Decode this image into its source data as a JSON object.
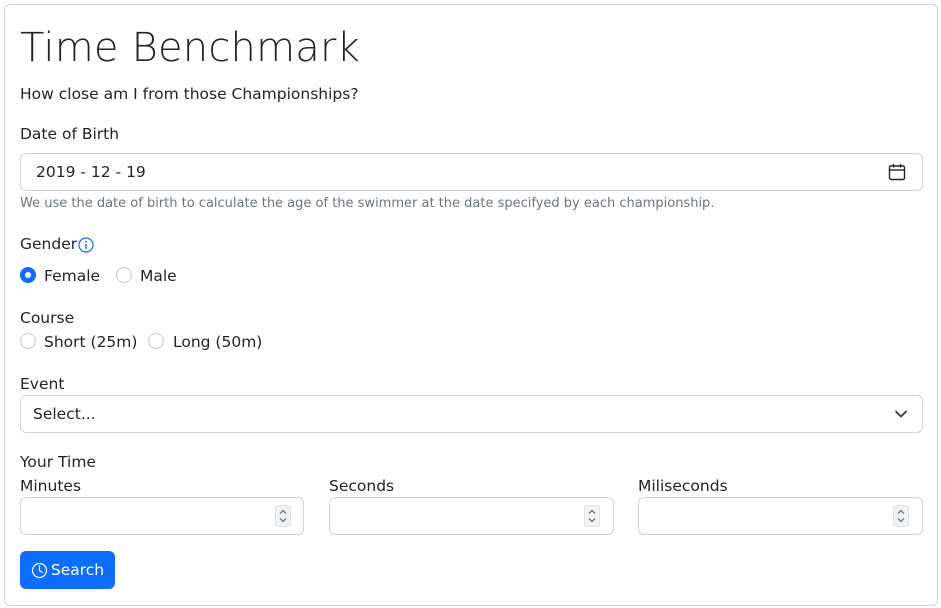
{
  "page": {
    "title": "Time Benchmark",
    "subtitle": "How close am I from those Championships?"
  },
  "dob": {
    "label": "Date of Birth",
    "value": "2019 - 12 - 19",
    "help": "We use the date of birth to calculate the age of the swimmer at the date specifyed by each championship.",
    "icon": "calendar-icon"
  },
  "gender": {
    "label": "Gender",
    "info_icon": "info-icon",
    "options": [
      {
        "label": "Female",
        "checked": true
      },
      {
        "label": "Male",
        "checked": false
      }
    ]
  },
  "course": {
    "label": "Course",
    "options": [
      {
        "label": "Short (25m)",
        "checked": false
      },
      {
        "label": "Long (50m)",
        "checked": false
      }
    ]
  },
  "event": {
    "label": "Event",
    "selected": "Select...",
    "icon": "chevron-down-icon"
  },
  "time": {
    "label": "Your Time",
    "minutes_label": "Minutes",
    "seconds_label": "Seconds",
    "milliseconds_label": "Miliseconds",
    "minutes_value": "",
    "seconds_value": "",
    "milliseconds_value": ""
  },
  "search": {
    "label": "Search",
    "icon": "clock-icon"
  },
  "colors": {
    "primary": "#0d6efd",
    "border": "#ced4da",
    "muted": "#6c757d"
  }
}
